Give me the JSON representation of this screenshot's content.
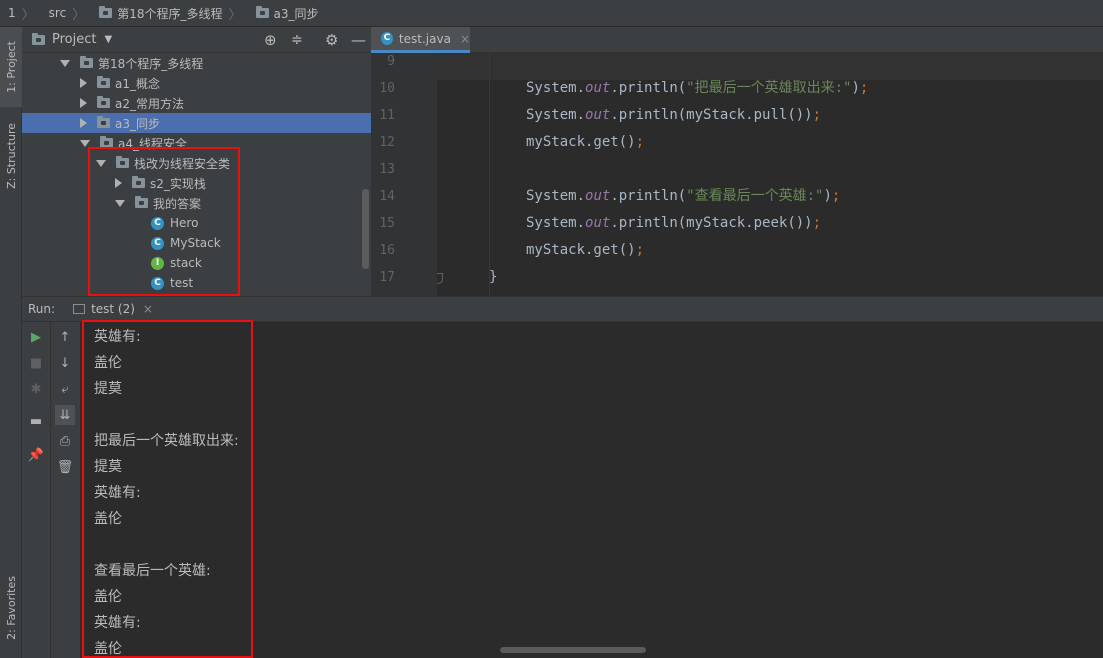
{
  "breadcrumb": [
    {
      "label": "1",
      "icon": ""
    },
    {
      "label": "src",
      "icon": ""
    },
    {
      "label": "第18个程序_多线程",
      "icon": "folder"
    },
    {
      "label": "a3_同步",
      "icon": "folder"
    }
  ],
  "sidebar_tabs": {
    "project": "1: Project",
    "structure": "Z: Structure",
    "favorites": "2: Favorites"
  },
  "project_panel": {
    "title": "Project",
    "tree": [
      {
        "label": "第18个程序_多线程",
        "type": "folder",
        "expanded": true,
        "depth": 0
      },
      {
        "label": "a1_概念",
        "type": "folder",
        "expanded": false,
        "depth": 1
      },
      {
        "label": "a2_常用方法",
        "type": "folder",
        "expanded": false,
        "depth": 1
      },
      {
        "label": "a3_同步",
        "type": "folder",
        "expanded": false,
        "depth": 1,
        "selected": true
      },
      {
        "label": "a4_线程安全",
        "type": "folder",
        "expanded": true,
        "depth": 1
      },
      {
        "label": "栈改为线程安全类",
        "type": "folder",
        "expanded": true,
        "depth": 2
      },
      {
        "label": "s2_实现栈",
        "type": "folder",
        "expanded": false,
        "depth": 3
      },
      {
        "label": "我的答案",
        "type": "folder",
        "expanded": true,
        "depth": 3
      },
      {
        "label": "Hero",
        "type": "class",
        "depth": 4
      },
      {
        "label": "MyStack",
        "type": "class",
        "depth": 4
      },
      {
        "label": "stack",
        "type": "interface",
        "depth": 4
      },
      {
        "label": "test",
        "type": "class",
        "depth": 4
      }
    ]
  },
  "editor": {
    "tab_label": "test.java",
    "lines": [
      {
        "num": "9",
        "parts": []
      },
      {
        "num": "10",
        "parts": [
          [
            "plain",
            "System."
          ],
          [
            "field",
            "out"
          ],
          [
            "plain",
            ".println("
          ],
          [
            "str",
            "\"把最后一个英雄取出来:\""
          ],
          [
            "plain",
            ")"
          ],
          [
            "punc",
            ";"
          ]
        ]
      },
      {
        "num": "11",
        "parts": [
          [
            "plain",
            "System."
          ],
          [
            "field",
            "out"
          ],
          [
            "plain",
            ".println(myStack.pull())"
          ],
          [
            "punc",
            ";"
          ]
        ]
      },
      {
        "num": "12",
        "parts": [
          [
            "plain",
            "myStack.get()"
          ],
          [
            "punc",
            ";"
          ]
        ]
      },
      {
        "num": "13",
        "parts": []
      },
      {
        "num": "14",
        "parts": [
          [
            "plain",
            "System."
          ],
          [
            "field",
            "out"
          ],
          [
            "plain",
            ".println("
          ],
          [
            "str",
            "\"查看最后一个英雄:\""
          ],
          [
            "plain",
            ")"
          ],
          [
            "punc",
            ";"
          ]
        ]
      },
      {
        "num": "15",
        "parts": [
          [
            "plain",
            "System."
          ],
          [
            "field",
            "out"
          ],
          [
            "plain",
            ".println(myStack.peek())"
          ],
          [
            "punc",
            ";"
          ]
        ]
      },
      {
        "num": "16",
        "parts": [
          [
            "plain",
            "myStack.get()"
          ],
          [
            "punc",
            ";"
          ]
        ]
      },
      {
        "num": "17",
        "parts": [
          [
            "brace",
            "}"
          ]
        ]
      }
    ]
  },
  "run_panel": {
    "label": "Run:",
    "tab_label": "test (2)",
    "output": [
      "英雄有:",
      "盖伦",
      "提莫",
      "",
      "把最后一个英雄取出来:",
      "提莫",
      "英雄有:",
      "盖伦",
      "",
      "查看最后一个英雄:",
      "盖伦",
      "英雄有:",
      "盖伦"
    ]
  },
  "colors": {
    "highlight_box": "#e81010",
    "selection": "#4b6eaf",
    "string": "#6a8759",
    "field": "#9876aa"
  }
}
